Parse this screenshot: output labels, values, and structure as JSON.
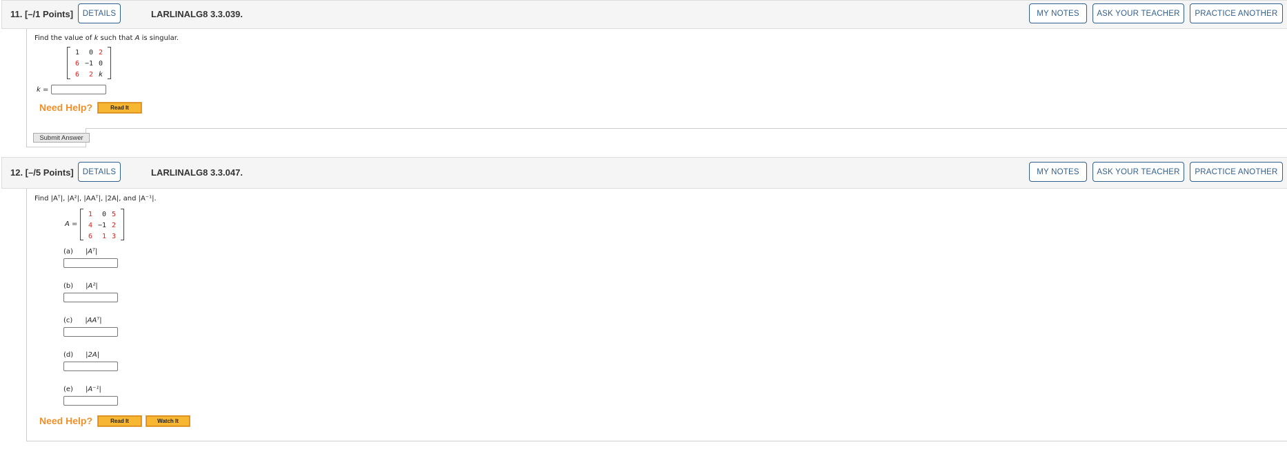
{
  "questions": [
    {
      "number": "11.",
      "points": "[–/1 Points]",
      "header_label": "11.  [–/1 Points]",
      "details_label": "DETAILS",
      "code": "LARLINALG8 3.3.039.",
      "my_notes_label": "MY NOTES",
      "ask_teacher_label": "ASK YOUR TEACHER",
      "practice_label": "PRACTICE ANOTHER",
      "prompt_parts": [
        "Find the value of ",
        "k",
        " such that ",
        "A",
        " is singular."
      ],
      "matrix": [
        [
          {
            "v": "1",
            "c": "black"
          },
          {
            "v": "0",
            "c": "black"
          },
          {
            "v": "2",
            "c": "red"
          }
        ],
        [
          {
            "v": "6",
            "c": "red"
          },
          {
            "v": "−1",
            "c": "black"
          },
          {
            "v": "0",
            "c": "black"
          }
        ],
        [
          {
            "v": "6",
            "c": "red"
          },
          {
            "v": "2",
            "c": "red"
          },
          {
            "v": "k",
            "c": "black"
          }
        ]
      ],
      "answer_label_var": "k",
      "answer_label_eq": " =",
      "answer_value": "",
      "need_help_label": "Need Help?",
      "read_it_label": "Read It",
      "submit_label": "Submit Answer"
    },
    {
      "number": "12.",
      "points": "[–/5 Points]",
      "header_label": "12.  [–/5 Points]",
      "details_label": "DETAILS",
      "code": "LARLINALG8 3.3.047.",
      "my_notes_label": "MY NOTES",
      "ask_teacher_label": "ASK YOUR TEACHER",
      "practice_label": "PRACTICE ANOTHER",
      "prompt": "Find |Aᵀ|, |A²|, |AAᵀ|, |2A|, and |A⁻¹|.",
      "matrix_name": "A =",
      "matrix": [
        [
          {
            "v": "1",
            "c": "red"
          },
          {
            "v": "0",
            "c": "black"
          },
          {
            "v": "5",
            "c": "red"
          }
        ],
        [
          {
            "v": "4",
            "c": "red"
          },
          {
            "v": "−1",
            "c": "black"
          },
          {
            "v": "2",
            "c": "red"
          }
        ],
        [
          {
            "v": "6",
            "c": "red"
          },
          {
            "v": "1",
            "c": "red"
          },
          {
            "v": "3",
            "c": "red"
          }
        ]
      ],
      "parts": [
        {
          "letter": "(a)",
          "expr": "|Aᵀ|",
          "value": ""
        },
        {
          "letter": "(b)",
          "expr": "|A²|",
          "value": ""
        },
        {
          "letter": "(c)",
          "expr": "|AAᵀ|",
          "value": ""
        },
        {
          "letter": "(d)",
          "expr": "|2A|",
          "value": ""
        },
        {
          "letter": "(e)",
          "expr": "|A⁻¹|",
          "value": ""
        }
      ],
      "need_help_label": "Need Help?",
      "read_it_label": "Read It",
      "watch_it_label": "Watch It"
    }
  ],
  "colors": {
    "accent_blue": "#2f5f8f",
    "help_orange": "#f0902a",
    "help_button": "#f7b733",
    "matrix_red": "#e01b1b"
  }
}
